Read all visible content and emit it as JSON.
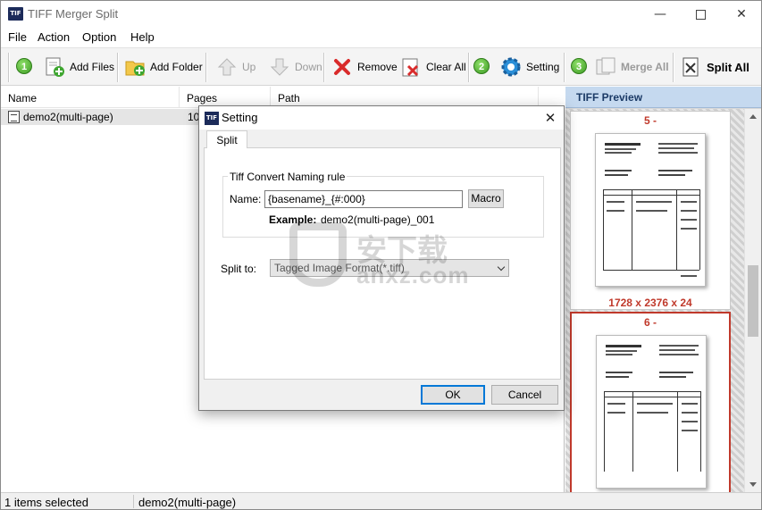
{
  "window": {
    "title": "TIFF Merger Split",
    "app_icon": "TIF"
  },
  "menu": [
    "File",
    "Action",
    "Option",
    "Help"
  ],
  "toolbar": {
    "step1": "1",
    "add_files": "Add Files",
    "add_folder": "Add Folder",
    "up": "Up",
    "down": "Down",
    "remove": "Remove",
    "clear_all": "Clear All",
    "step2": "2",
    "setting": "Setting",
    "step3": "3",
    "merge_all": "Merge All",
    "split_all": "Split All"
  },
  "list": {
    "columns": [
      "Name",
      "Pages",
      "Path"
    ],
    "rows": [
      {
        "name": "demo2(multi-page)",
        "pages": "10",
        "path": ""
      }
    ]
  },
  "preview": {
    "title": "TIFF Preview",
    "items": [
      {
        "num": "5 -",
        "size": "1728 x 2376 x 24"
      },
      {
        "num": "6 -",
        "size": ""
      }
    ]
  },
  "status": {
    "selected": "1 items selected",
    "file": "demo2(multi-page)"
  },
  "dialog": {
    "title": "Setting",
    "icon": "TIF",
    "tab": "Split",
    "group_title": "Tiff Convert Naming rule",
    "name_label": "Name:",
    "name_value": "{basename}_{#:000}",
    "macro_button": "Macro",
    "example_label": "Example:",
    "example_value": "demo2(multi-page)_001",
    "split_to_label": "Split to:",
    "split_to_value": "Tagged Image Format(*.tiff)",
    "ok": "OK",
    "cancel": "Cancel"
  },
  "watermark": {
    "cn": "安下载",
    "url": "anxz.com"
  },
  "colors": {
    "accent": "#0078d7",
    "preview_red": "#c0392b",
    "preview_header": "#c5d9ef"
  }
}
